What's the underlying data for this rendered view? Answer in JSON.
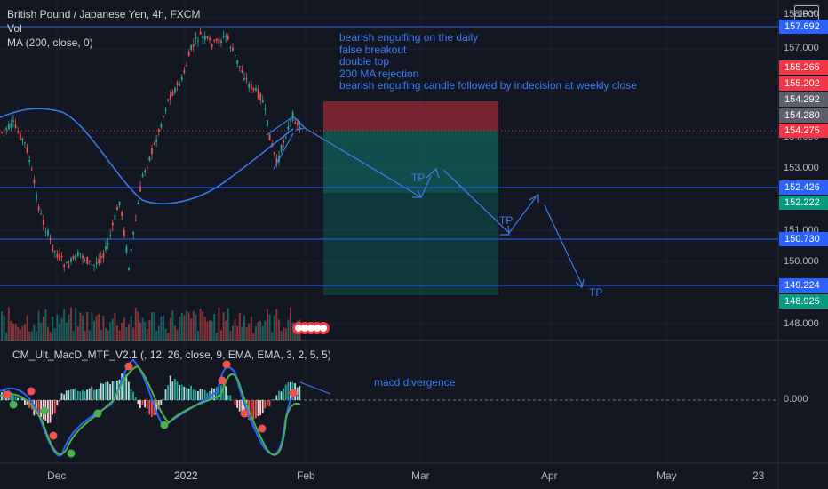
{
  "header": {
    "symbol": "British Pound / Japanese Yen, 4h, FXCM",
    "vol": "Vol",
    "ma": "MA (200, close, 0)"
  },
  "currency": "JPY",
  "annotations": [
    "bearish engulfing on the daily",
    "false breakout",
    "double top",
    "200 MA rejection",
    "bearish engulfing candle followed by indecision at weekly close"
  ],
  "tp_label": "TP",
  "macd": {
    "label": "CM_Ult_MacD_MTF_V2.1 (, 12, 26, close, 9, EMA, EMA, 3, 2, 5, 5)",
    "note": "macd divergence",
    "zero": "0.000"
  },
  "price_axis": [
    "158.000",
    "157.000",
    "154.000",
    "153.000",
    "151.000",
    "150.000",
    "148.000"
  ],
  "price_badges": [
    {
      "value": "157.692",
      "color": "#2962ff"
    },
    {
      "value": "155.265",
      "color": "#f23645"
    },
    {
      "value": "155.202",
      "color": "#f23645"
    },
    {
      "value": "154.292",
      "color": "#5d606b"
    },
    {
      "value": "154.280",
      "color": "#5d606b"
    },
    {
      "value": "154.275",
      "color": "#f23645"
    },
    {
      "value": "152.426",
      "color": "#2962ff"
    },
    {
      "value": "152.222",
      "color": "#089981"
    },
    {
      "value": "150.730",
      "color": "#2962ff"
    },
    {
      "value": "149.224",
      "color": "#2962ff"
    },
    {
      "value": "148.925",
      "color": "#089981"
    }
  ],
  "time_axis": [
    "Dec",
    "2022",
    "Feb",
    "Mar",
    "Apr",
    "May",
    "23"
  ]
}
